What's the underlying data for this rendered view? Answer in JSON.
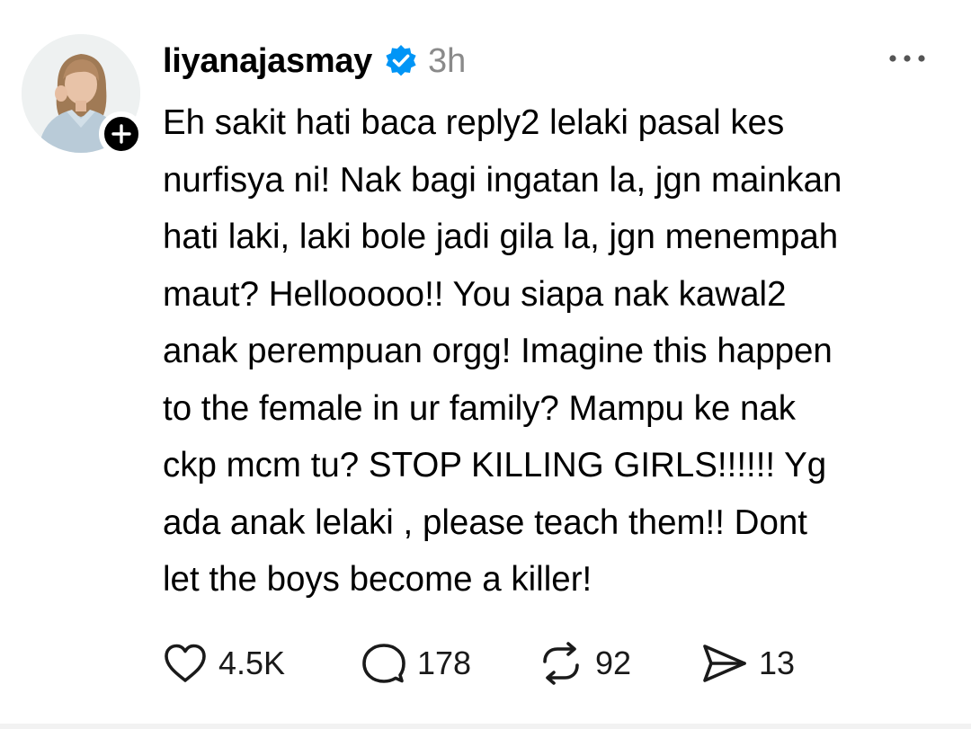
{
  "post": {
    "username": "liyanajasmay",
    "timestamp": "3h",
    "verified": true,
    "body_lines": [
      "Eh sakit hati baca reply2 lelaki pasal kes",
      "nurfisya ni! Nak bagi ingatan la, jgn mainkan",
      "hati laki, laki bole jadi gila la, jgn menempah",
      "maut? Hellooooo!! You siapa nak kawal2",
      "anak perempuan orgg! Imagine this happen",
      "to the female in ur family? Mampu ke nak",
      "ckp mcm tu? STOP KILLING GIRLS!!!!!! Yg",
      "ada anak lelaki , please teach them!! Dont",
      "let the boys become a killer!"
    ]
  },
  "actions": {
    "like_count": "4.5K",
    "reply_count": "178",
    "repost_count": "92",
    "share_count": "13"
  },
  "icons": {
    "verified": "verified-badge-icon",
    "follow": "plus-icon",
    "more": "more-horizontal-icon",
    "like": "heart-icon",
    "reply": "comment-bubble-icon",
    "repost": "repost-icon",
    "share": "send-icon"
  },
  "colors": {
    "verified_blue": "#0095f6",
    "timestamp_gray": "#8a8a8a",
    "text": "#000000"
  }
}
